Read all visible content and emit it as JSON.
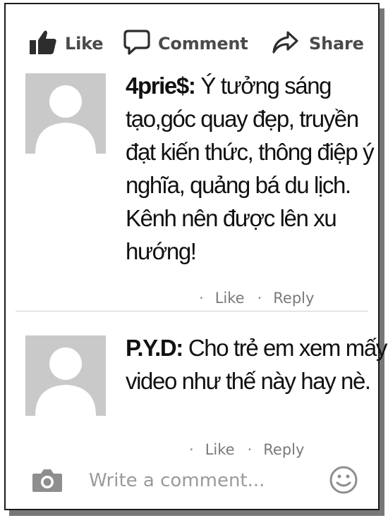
{
  "actions": {
    "like_label": "Like",
    "comment_label": "Comment",
    "share_label": "Share"
  },
  "comments": [
    {
      "author": "4prie$:",
      "text": "Ý tưởng sáng tạo,góc quay đẹp, truyền đạt kiến thức, thông điệp ý nghĩa, quảng bá du lịch. Kênh nên được lên xu hướng!",
      "like_label": "Like",
      "reply_label": "Reply",
      "separator": "·"
    },
    {
      "author": "P.Y.D:",
      "text": "Cho trẻ em xem mấy video như thế này hay nè.",
      "like_label": "Like",
      "reply_label": "Reply",
      "separator": "·"
    }
  ],
  "composer": {
    "placeholder": "Write a comment..."
  },
  "icons": {
    "like": "thumbs-up-icon",
    "comment": "speech-bubble-icon",
    "share": "share-arrow-icon",
    "avatar": "default-avatar-icon",
    "camera": "camera-icon",
    "emoji": "smiley-icon"
  },
  "colors": {
    "action_text": "#4a4a4a",
    "meta_text": "#7a7a7a",
    "avatar_bg": "#c9c9c9",
    "placeholder": "#9a9a9a"
  }
}
